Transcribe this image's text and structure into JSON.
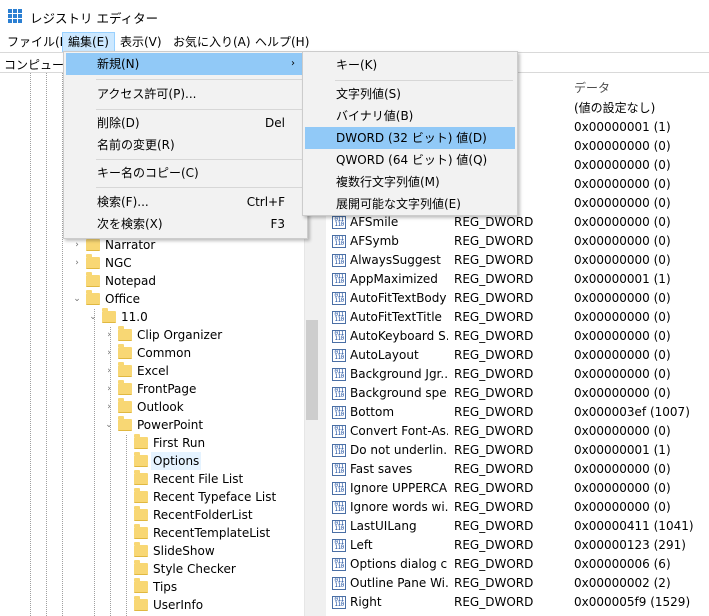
{
  "window": {
    "title": "レジストリ エディター"
  },
  "menubar": [
    "ファイル(F)",
    "編集(E)",
    "表示(V)",
    "お気に入り(A)",
    "ヘルプ(H)"
  ],
  "address": "コンピューター",
  "edit_menu": {
    "new": "新規(N)",
    "permissions": "アクセス許可(P)...",
    "delete": "削除(D)",
    "delete_shortcut": "Del",
    "rename": "名前の変更(R)",
    "copy_key_name": "キー名のコピー(C)",
    "find": "検索(F)...",
    "find_shortcut": "Ctrl+F",
    "find_next": "次を検索(X)",
    "find_next_shortcut": "F3"
  },
  "new_submenu": {
    "key": "キー(K)",
    "string": "文字列値(S)",
    "binary": "バイナリ値(B)",
    "dword": "DWORD (32 ビット) 値(D)",
    "qword": "QWORD (64 ビット) 値(Q)",
    "multi_string": "複数行文字列値(M)",
    "expandable_string": "展開可能な文字列値(E)"
  },
  "tree": [
    {
      "label": "Narrator",
      "expander": "›"
    },
    {
      "label": "NGC",
      "expander": "›"
    },
    {
      "label": "Notepad",
      "expander": ""
    },
    {
      "label": "Office",
      "expander": "⌄"
    },
    {
      "label": "11.0",
      "expander": "⌄"
    },
    {
      "label": "Clip Organizer",
      "expander": "›"
    },
    {
      "label": "Common",
      "expander": "›"
    },
    {
      "label": "Excel",
      "expander": "›"
    },
    {
      "label": "FrontPage",
      "expander": "›"
    },
    {
      "label": "Outlook",
      "expander": "›"
    },
    {
      "label": "PowerPoint",
      "expander": "⌄"
    },
    {
      "label": "First Run",
      "expander": ""
    },
    {
      "label": "Options",
      "expander": "",
      "selected": true
    },
    {
      "label": "Recent File List",
      "expander": ""
    },
    {
      "label": "Recent Typeface List",
      "expander": ""
    },
    {
      "label": "RecentFolderList",
      "expander": ""
    },
    {
      "label": "RecentTemplateList",
      "expander": ""
    },
    {
      "label": "SlideShow",
      "expander": ""
    },
    {
      "label": "Style Checker",
      "expander": ""
    },
    {
      "label": "Tips",
      "expander": ""
    },
    {
      "label": "UserInfo",
      "expander": ""
    }
  ],
  "values_header": {
    "data": "データ"
  },
  "values_data_only": [
    "(値の設定なし)",
    "0x00000001 (1)",
    "0x00000000 (0)",
    "0x00000000 (0)",
    "0x00000000 (0)",
    "0x00000000 (0)"
  ],
  "values": [
    {
      "name": "AFSmile",
      "type": "REG_DWORD",
      "data": "0x00000000 (0)"
    },
    {
      "name": "AFSymb",
      "type": "REG_DWORD",
      "data": "0x00000000 (0)"
    },
    {
      "name": "AlwaysSuggest",
      "type": "REG_DWORD",
      "data": "0x00000000 (0)"
    },
    {
      "name": "AppMaximized",
      "type": "REG_DWORD",
      "data": "0x00000001 (1)"
    },
    {
      "name": "AutoFitTextBody",
      "type": "REG_DWORD",
      "data": "0x00000000 (0)"
    },
    {
      "name": "AutoFitTextTitle",
      "type": "REG_DWORD",
      "data": "0x00000000 (0)"
    },
    {
      "name": "AutoKeyboard S...",
      "type": "REG_DWORD",
      "data": "0x00000000 (0)"
    },
    {
      "name": "AutoLayout",
      "type": "REG_DWORD",
      "data": "0x00000000 (0)"
    },
    {
      "name": "Background Jgr...",
      "type": "REG_DWORD",
      "data": "0x00000000 (0)"
    },
    {
      "name": "Background spe...",
      "type": "REG_DWORD",
      "data": "0x00000000 (0)"
    },
    {
      "name": "Bottom",
      "type": "REG_DWORD",
      "data": "0x000003ef (1007)"
    },
    {
      "name": "Convert Font-As...",
      "type": "REG_DWORD",
      "data": "0x00000000 (0)"
    },
    {
      "name": "Do not underlin...",
      "type": "REG_DWORD",
      "data": "0x00000001 (1)"
    },
    {
      "name": "Fast saves",
      "type": "REG_DWORD",
      "data": "0x00000000 (0)"
    },
    {
      "name": "Ignore UPPERCA...",
      "type": "REG_DWORD",
      "data": "0x00000000 (0)"
    },
    {
      "name": "Ignore words wi...",
      "type": "REG_DWORD",
      "data": "0x00000000 (0)"
    },
    {
      "name": "LastUILang",
      "type": "REG_DWORD",
      "data": "0x00000411 (1041)"
    },
    {
      "name": "Left",
      "type": "REG_DWORD",
      "data": "0x00000123 (291)"
    },
    {
      "name": "Options dialog c...",
      "type": "REG_DWORD",
      "data": "0x00000006 (6)"
    },
    {
      "name": "Outline Pane Wi...",
      "type": "REG_DWORD",
      "data": "0x00000002 (2)"
    },
    {
      "name": "Right",
      "type": "REG_DWORD",
      "data": "0x000005f9 (1529)"
    }
  ]
}
